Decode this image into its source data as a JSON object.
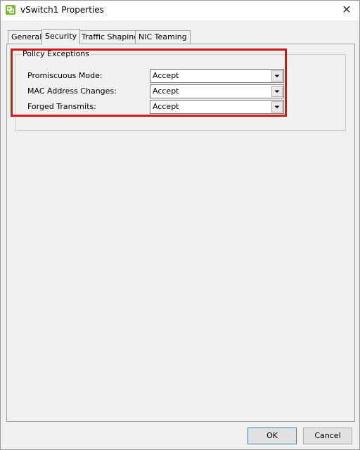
{
  "window": {
    "title": "vSwitch1 Properties",
    "close_glyph": "✕"
  },
  "tabs": [
    {
      "label": "General"
    },
    {
      "label": "Security",
      "selected": true
    },
    {
      "label": "Traffic Shaping"
    },
    {
      "label": "NIC Teaming"
    }
  ],
  "policy": {
    "group_title": "Policy Exceptions",
    "fields": [
      {
        "label": "Promiscuous Mode:",
        "value": "Accept"
      },
      {
        "label": "MAC Address Changes:",
        "value": "Accept"
      },
      {
        "label": "Forged Transmits:",
        "value": "Accept"
      }
    ]
  },
  "buttons": {
    "ok": "OK",
    "cancel": "Cancel"
  },
  "colors": {
    "highlight": "#d0151d",
    "app_icon": "#7db72f"
  }
}
